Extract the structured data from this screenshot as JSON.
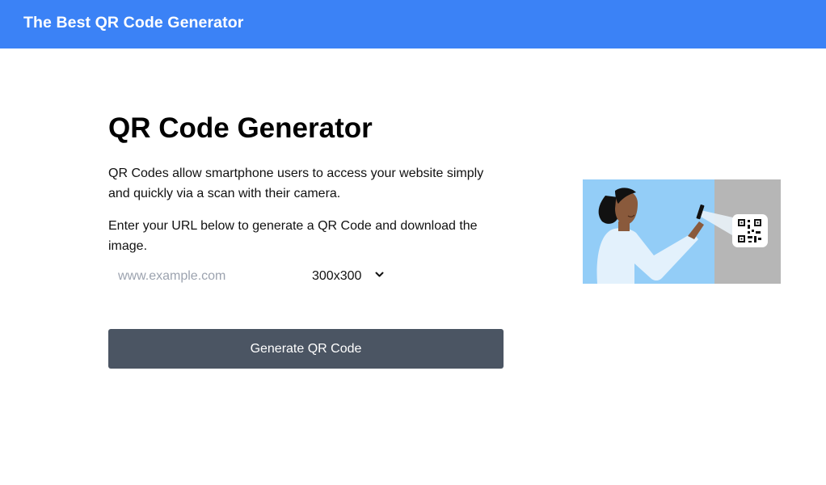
{
  "header": {
    "brand": "The Best QR Code Generator"
  },
  "main": {
    "title": "QR Code Generator",
    "paragraph1": "QR Codes allow smartphone users to access your website simply and quickly via a scan with their camera.",
    "paragraph2": "Enter your URL below to generate a QR Code and download the image.",
    "url_input": {
      "placeholder": "www.example.com",
      "value": ""
    },
    "size_select": {
      "selected": "300x300"
    },
    "generate_button": "Generate QR Code"
  },
  "colors": {
    "header_bg": "#3b82f6",
    "button_bg": "#4b5563",
    "illustration_sky": "#93cdf7",
    "illustration_wall": "#b6b6b6"
  },
  "icons": [
    "chevron-down-icon",
    "qr-code-icon",
    "person-scanning-illustration"
  ]
}
